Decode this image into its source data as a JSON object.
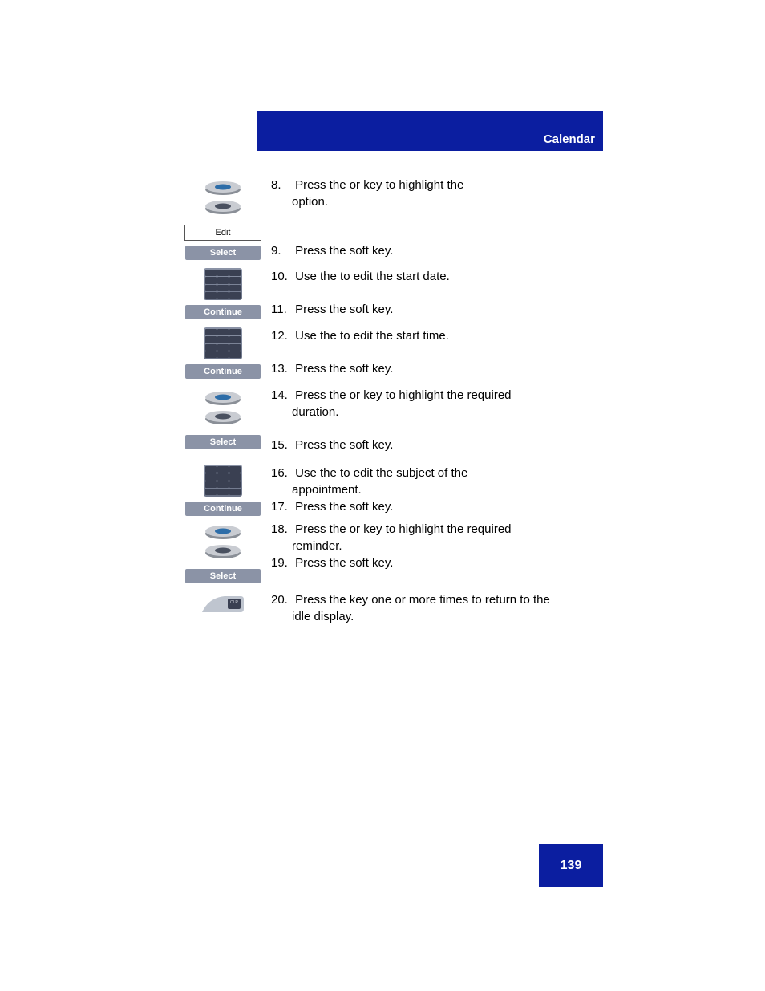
{
  "header": {
    "section": "Calendar"
  },
  "page_number": "139",
  "labels": {
    "edit": "Edit",
    "select": "Select",
    "continue": "Continue"
  },
  "steps": {
    "s8": {
      "num": "8.",
      "a": "Press the ",
      "b": " or ",
      "c": " key to highlight the ",
      "d": "option."
    },
    "s9": {
      "num": "9.",
      "a": "Press the ",
      "b": " soft key."
    },
    "s10": {
      "num": "10.",
      "a": "Use the ",
      "b": " to edit the start date."
    },
    "s11": {
      "num": "11.",
      "a": "Press the ",
      "b": " soft key."
    },
    "s12": {
      "num": "12.",
      "a": "Use the ",
      "b": " to edit the start time."
    },
    "s13": {
      "num": "13.",
      "a": "Press the ",
      "b": " soft key."
    },
    "s14": {
      "num": "14.",
      "a": "Press the ",
      "b": " or ",
      "c": " key to highlight the required ",
      "d": "duration."
    },
    "s15": {
      "num": "15.",
      "a": "Press the ",
      "b": " soft key."
    },
    "s16": {
      "num": "16.",
      "a": "Use the ",
      "b": " to edit the subject of the ",
      "c": "appointment."
    },
    "s17": {
      "num": "17.",
      "a": "Press the ",
      "b": " soft key."
    },
    "s18": {
      "num": "18.",
      "a": "Press the ",
      "b": " or ",
      "c": " key to highlight the required ",
      "d": "reminder."
    },
    "s19": {
      "num": "19.",
      "a": "Press the ",
      "b": " soft key."
    },
    "s20": {
      "num": "20.",
      "a": "Press the ",
      "b": " key one or more times to return to the ",
      "c": "idle display."
    }
  }
}
